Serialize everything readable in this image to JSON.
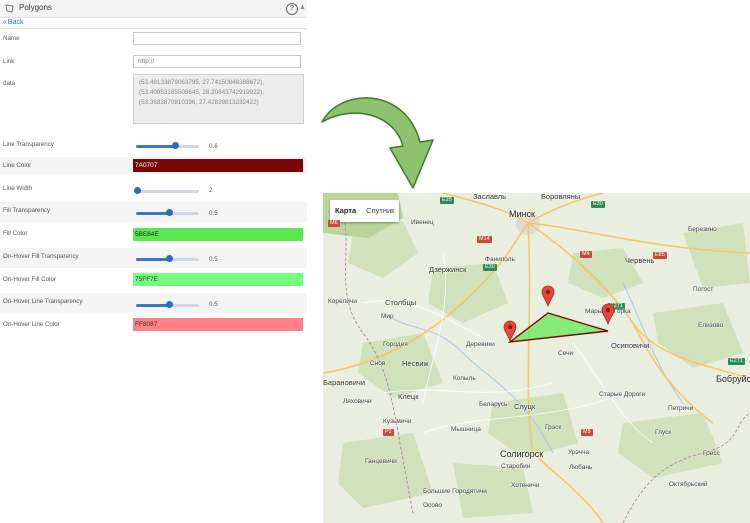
{
  "panel": {
    "title": "Polygons",
    "help_icon": "?",
    "back_label": "Back",
    "fields": {
      "name_label": "Name",
      "name_value": "",
      "link_label": "Link",
      "link_placeholder": "http://",
      "data_label": "data",
      "data_lines": [
        "(53.49133879063795, 27.74150848388672),",
        "(53.40953185508645, 28.20843742919922),",
        "(53.3683870810396, 27.42839813232422)"
      ],
      "line_transparency_label": "Line Transparency",
      "line_transparency_value": "0.6",
      "line_transparency_fraction": 0.6,
      "line_color_label": "Line Color",
      "line_color_value": "7A0707",
      "line_color_hex": "#7A0707",
      "line_width_label": "Line Width",
      "line_width_value": "2",
      "line_width_fraction": 0.0,
      "fill_transparency_label": "Fill Transparency",
      "fill_transparency_value": "0.5",
      "fill_transparency_fraction": 0.5,
      "fill_color_label": "Fill Color",
      "fill_color_value": "5BE84E",
      "fill_color_hex": "#5BE84E",
      "hover_fill_transparency_label": "On-Hover Fill Transparency",
      "hover_fill_transparency_value": "0.5",
      "hover_fill_transparency_fraction": 0.5,
      "hover_fill_color_label": "On-Hover Fill Color",
      "hover_fill_color_value": "75FF7E",
      "hover_fill_color_hex": "#75FF7E",
      "hover_line_transparency_label": "On-Hover Line Transparency",
      "hover_line_transparency_value": "0.5",
      "hover_line_transparency_fraction": 0.5,
      "hover_line_color_label": "On-Hover Line Color",
      "hover_line_color_value": "FF8087",
      "hover_line_color_hex": "#FF8087"
    }
  },
  "map": {
    "tabs": [
      "Карта",
      "Спутник"
    ],
    "cities": {
      "minsk": "Минск",
      "zaslavl": "Заславль",
      "borovlyany": "Боровляны",
      "ivenets": "Ивенец",
      "dzerzhinsk": "Дзержинск",
      "fanipol": "Фаниполь",
      "chervyen": "Червень",
      "berezino": "Березино",
      "korelichi": "Кореличи",
      "stolbtsy": "Столбцы",
      "marina_gorka": "Марьина Горка",
      "mir": "Мир",
      "gorodeya": "Городея",
      "osipovichi": "Осиповичи",
      "elizovo": "Елизово",
      "nesvizh": "Несвиж",
      "snov": "Снов",
      "kopyl": "Копыль",
      "baranovichi": "Барановичи",
      "lyakhovichi": "Ляховичи",
      "kletsk": "Клецк",
      "belarus": "Беларусь",
      "slutsk": "Слуцк",
      "starye_dorogi": "Старые Дороги",
      "bobruisk": "Бобруйск",
      "glusk": "Глуск",
      "urechye": "Урэчча",
      "gantsevichi": "Ганцевичи",
      "soligorsk": "Солигорск",
      "starobin": "Старобин",
      "lyuban": "Любань",
      "oktyabrsky": "Октябрьский",
      "bolshiye_gorodyatichi": "Большие Городятичи",
      "khotenichi": "Хотеничи",
      "osovo": "Осово",
      "kuzmichi": "Кузьмичи",
      "gressk": "Грэск",
      "pogost": "Погост",
      "myshnitsa": "Мышница",
      "dereviki": "Деревики",
      "sechi": "Сечи",
      "petrichi": "Петричи",
      "gress": "Гресс"
    },
    "roads": {
      "e28": "E28",
      "e30a": "E30",
      "e30b": "E30",
      "m14": "M14",
      "m4": "M4",
      "e85": "E85",
      "e271": "E271",
      "e271b": "E271",
      "m6": "M6",
      "m5": "M5",
      "p2": "P2"
    },
    "polygon_fill": "#5BE84E",
    "polygon_stroke": "#7A0707",
    "marker_color": "#E8463A"
  },
  "arrow_color": "#8DC26F"
}
